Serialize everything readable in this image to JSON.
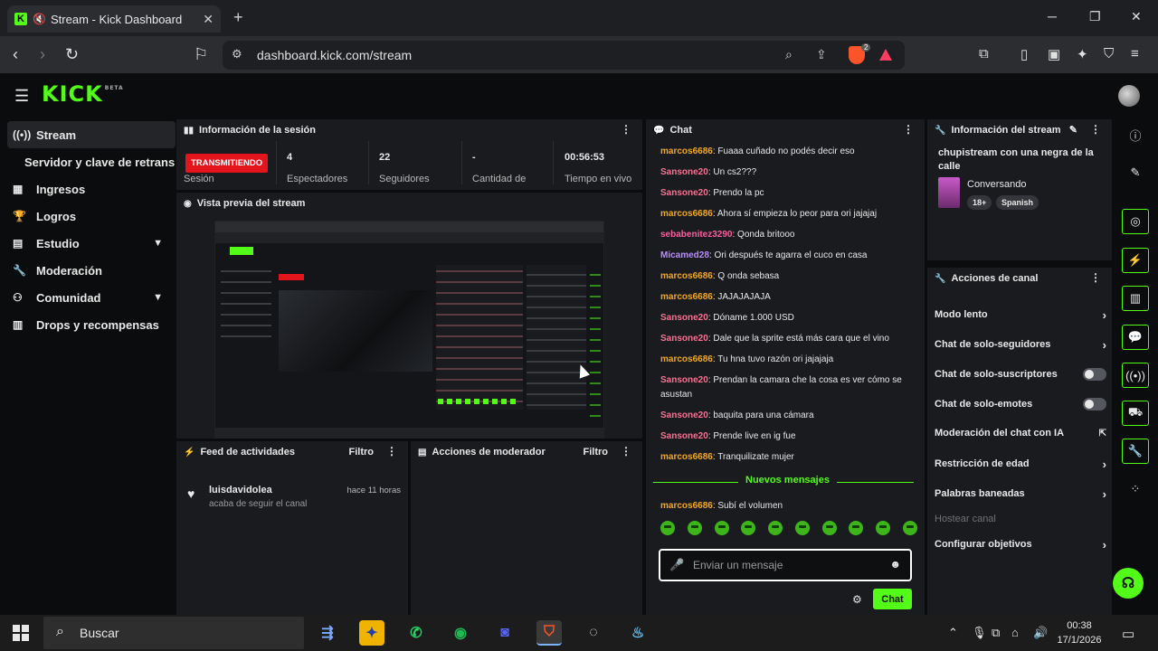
{
  "browser": {
    "tab_title": "Stream - Kick Dashboard",
    "url": "dashboard.kick.com/stream",
    "shield_count": "2"
  },
  "app": {
    "logo": "KICK",
    "logo_badge": "BETA"
  },
  "sidebar": {
    "items": [
      {
        "label": "Stream",
        "icon": "broadcast-icon"
      },
      {
        "label": "Servidor y clave de retransmisión",
        "icon": ""
      },
      {
        "label": "Ingresos",
        "icon": "bank-icon"
      },
      {
        "label": "Logros",
        "icon": "trophy-icon"
      },
      {
        "label": "Estudio",
        "icon": "studio-icon"
      },
      {
        "label": "Moderación",
        "icon": "wrench-icon"
      },
      {
        "label": "Comunidad",
        "icon": "community-icon"
      },
      {
        "label": "Drops y recompensas",
        "icon": "drops-icon"
      }
    ]
  },
  "session": {
    "title": "Información de la sesión",
    "status": "TRANSMITIENDO",
    "status_label": "Sesión",
    "viewers": "4",
    "viewers_label": "Espectadores",
    "followers": "22",
    "followers_label": "Seguidores",
    "amount": "-",
    "amount_label": "Cantidad de",
    "live_time": "00:56:53",
    "live_time_label": "Tiempo en vivo"
  },
  "preview": {
    "title": "Vista previa del stream"
  },
  "activity": {
    "title": "Feed de actividades",
    "filter": "Filtro",
    "items": [
      {
        "name": "luisdavidolea",
        "desc": "acaba de seguir el canal",
        "time": "hace 11 horas"
      }
    ]
  },
  "mod_actions": {
    "title": "Acciones de moderador",
    "filter": "Filtro"
  },
  "chat": {
    "title": "Chat",
    "messages": [
      {
        "user": "marcos6686",
        "text": "Fuaaa cuñado no podés decir eso",
        "color": "#f5a623"
      },
      {
        "user": "Sansone20",
        "text": "Un cs2???",
        "color": "#ff6f91"
      },
      {
        "user": "Sansone20",
        "text": "Prendo la pc",
        "color": "#ff6f91"
      },
      {
        "user": "marcos6686",
        "text": "Ahora sí empieza lo peor para ori jajajaj",
        "color": "#f5a623"
      },
      {
        "user": "sebabenitez3290",
        "text": "Qonda britooo",
        "color": "#ff5c9d"
      },
      {
        "user": "Micamed28",
        "text": "Ori después te agarra el cuco en casa",
        "color": "#b98cff"
      },
      {
        "user": "marcos6686",
        "text": "Q onda sebasa",
        "color": "#f5a623"
      },
      {
        "user": "marcos6686",
        "text": "JAJAJAJAJA",
        "color": "#f5a623"
      },
      {
        "user": "Sansone20",
        "text": "Dóname 1.000 USD",
        "color": "#ff6f91"
      },
      {
        "user": "Sansone20",
        "text": "Dale que la sprite está más cara que el vino",
        "color": "#ff6f91"
      },
      {
        "user": "marcos6686",
        "text": "Tu hna tuvo razón ori jajajaja",
        "color": "#f5a623"
      },
      {
        "user": "Sansone20",
        "text": "Prendan la camara che la cosa es ver cómo se asustan",
        "color": "#ff6f91"
      },
      {
        "user": "Sansone20",
        "text": "baquita para una cámara",
        "color": "#ff6f91"
      },
      {
        "user": "Sansone20",
        "text": "Prende live en ig fue",
        "color": "#ff6f91"
      },
      {
        "user": "marcos6686",
        "text": "Tranquilizate mujer",
        "color": "#f5a623"
      }
    ],
    "new_messages_label": "Nuevos mensajes",
    "after_messages": [
      {
        "user": "marcos6686",
        "text": "Subí el volumen",
        "color": "#f5a623"
      }
    ],
    "placeholder": "Enviar un mensaje",
    "send_label": "Chat"
  },
  "stream_info": {
    "title": "Información del stream",
    "stream_title": "chupistream con una negra de la calle",
    "category": "Conversando",
    "tags": [
      "18+",
      "Spanish"
    ]
  },
  "channel_actions": {
    "title": "Acciones de canal",
    "items": [
      {
        "label": "Modo lento",
        "kind": "chevron"
      },
      {
        "label": "Chat de solo-seguidores",
        "kind": "chevron"
      },
      {
        "label": "Chat de solo-suscriptores",
        "kind": "toggle"
      },
      {
        "label": "Chat de solo-emotes",
        "kind": "toggle"
      },
      {
        "label": "Moderación del chat con IA",
        "kind": "external"
      },
      {
        "label": "Restricción de edad",
        "kind": "chevron"
      },
      {
        "label": "Palabras baneadas",
        "kind": "chevron"
      },
      {
        "label": "Hostear canal",
        "kind": "disabled"
      },
      {
        "label": "Configurar objetivos",
        "kind": "chevron"
      }
    ]
  },
  "taskbar": {
    "search_placeholder": "Buscar",
    "time": "00:38",
    "date": "17/1/2026"
  },
  "colors": {
    "kick_green": "#53fc18",
    "live_red": "#e3141b",
    "panel": "#191b1f"
  }
}
